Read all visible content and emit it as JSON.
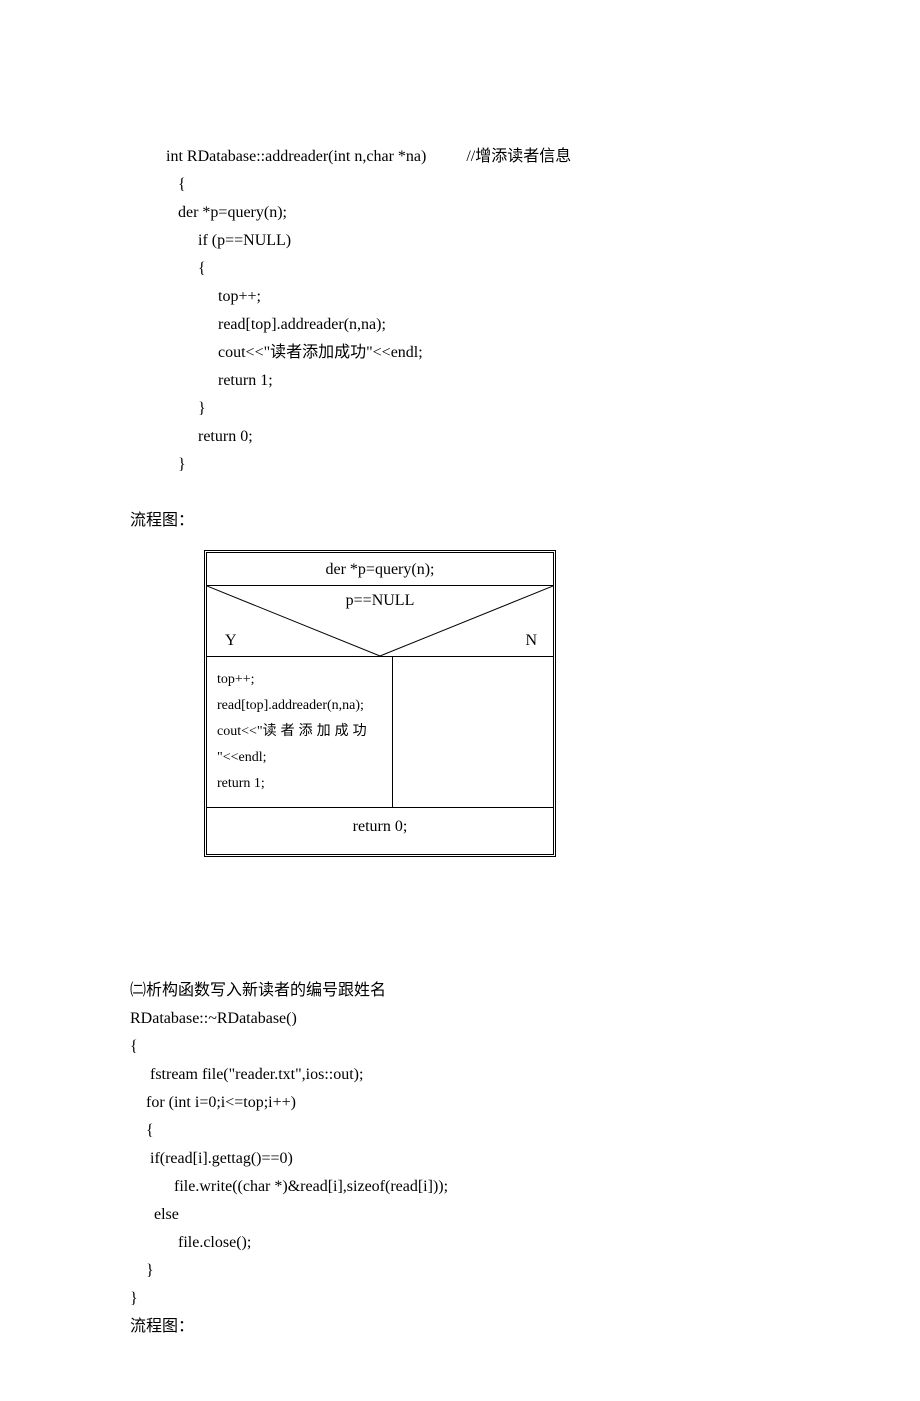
{
  "codeBlock1": {
    "signature": " int RDatabase::addreader(int n,char *na)          //增添读者信息",
    "l2": "    {",
    "l3": "    der *p=query(n);",
    "l4": "         if (p==NULL)",
    "l5": "         {",
    "l6": "              top++;",
    "l7": "              read[top].addreader(n,na);",
    "l8": "              cout<<\"读者添加成功\"<<endl;",
    "l9": "              return 1;",
    "l10": "         }",
    "l11": "         return 0;",
    "l12": "    }"
  },
  "flowLabel1": "流程图：",
  "flowchart1": {
    "top": "der *p=query(n);",
    "cond": "p==NULL",
    "yes": "Y",
    "no": "N",
    "left_l1": "top++;",
    "left_l2": "read[top].addreader(n,na);",
    "left_l3_prefix": "cout<<\"",
    "left_l3_cjk": "读者添加成功",
    "left_l4": "\"<<endl;",
    "left_l5": "return 1;",
    "bottom": "return 0;"
  },
  "section2Title": "㈡析构函数写入新读者的编号跟姓名",
  "codeBlock2": {
    "l1": "RDatabase::~RDatabase()",
    "l2": "{",
    "l3": "     fstream file(\"reader.txt\",ios::out);",
    "l4": "    for (int i=0;i<=top;i++)",
    "l5": "    {",
    "l6": "     if(read[i].gettag()==0)",
    "l7": "           file.write((char *)&read[i],sizeof(read[i]));",
    "l8": "      else",
    "l9": "            file.close();",
    "l10": "    }",
    "l11": "}"
  },
  "flowLabel2": "流程图："
}
